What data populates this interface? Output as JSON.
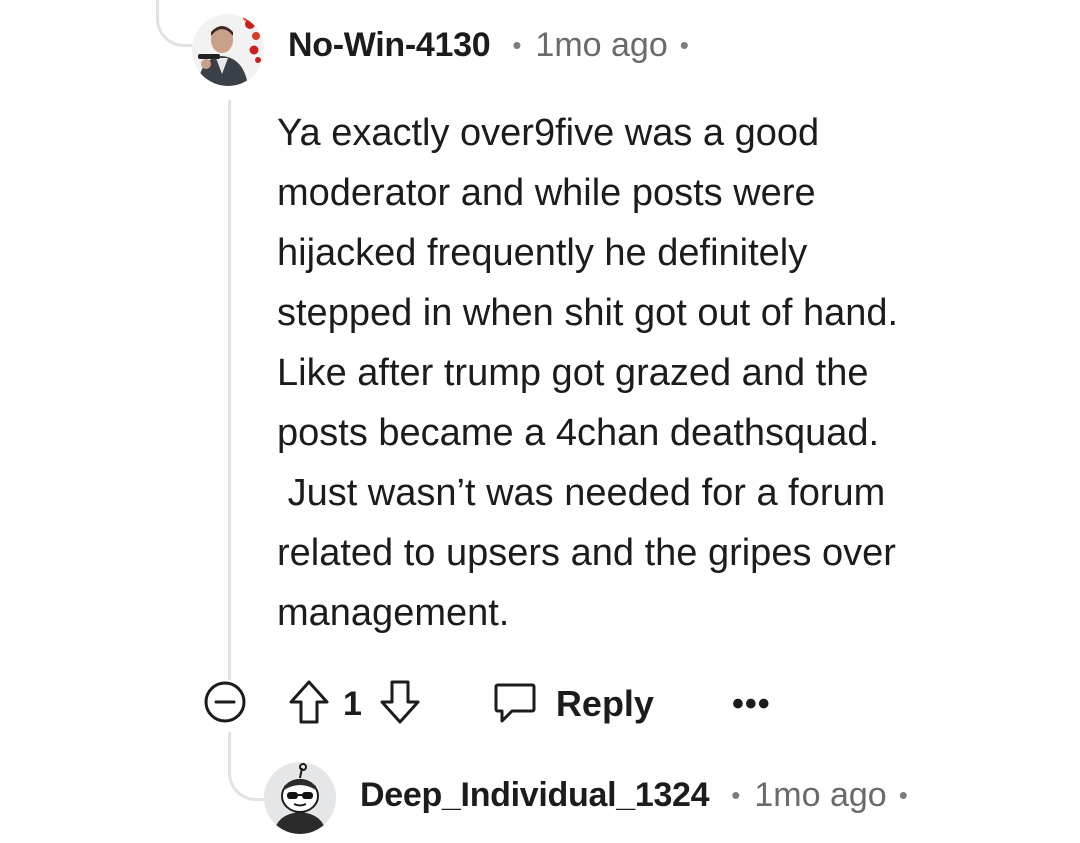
{
  "comment": {
    "username": "No-Win-4130",
    "separator": "•",
    "timestamp": "1mo ago",
    "trailing_dot": "•",
    "body": "Ya exactly over9five was a good\nmoderator and while posts were\nhijacked frequently he definitely\nstepped in when shit got out of hand.\nLike after trump got grazed and the\nposts became a 4chan deathsquad.\n Just wasn’t was needed for a forum\nrelated to upsers and the gripes over\nmanagement.",
    "vote_count": "1",
    "reply_label": "Reply",
    "more_label": "•••",
    "icons": {
      "collapse": "collapse-minus-icon",
      "upvote": "upvote-arrow-icon",
      "downvote": "downvote-arrow-icon",
      "reply": "speech-bubble-icon",
      "more": "more-dots-icon"
    }
  },
  "child_comment": {
    "username": "Deep_Individual_1324",
    "separator": "•",
    "timestamp": "1mo ago",
    "trailing_dot": "•"
  },
  "colors": {
    "text": "#1c1c1c",
    "meta": "#6a6a6a",
    "thread_line": "#e2e2e2"
  }
}
